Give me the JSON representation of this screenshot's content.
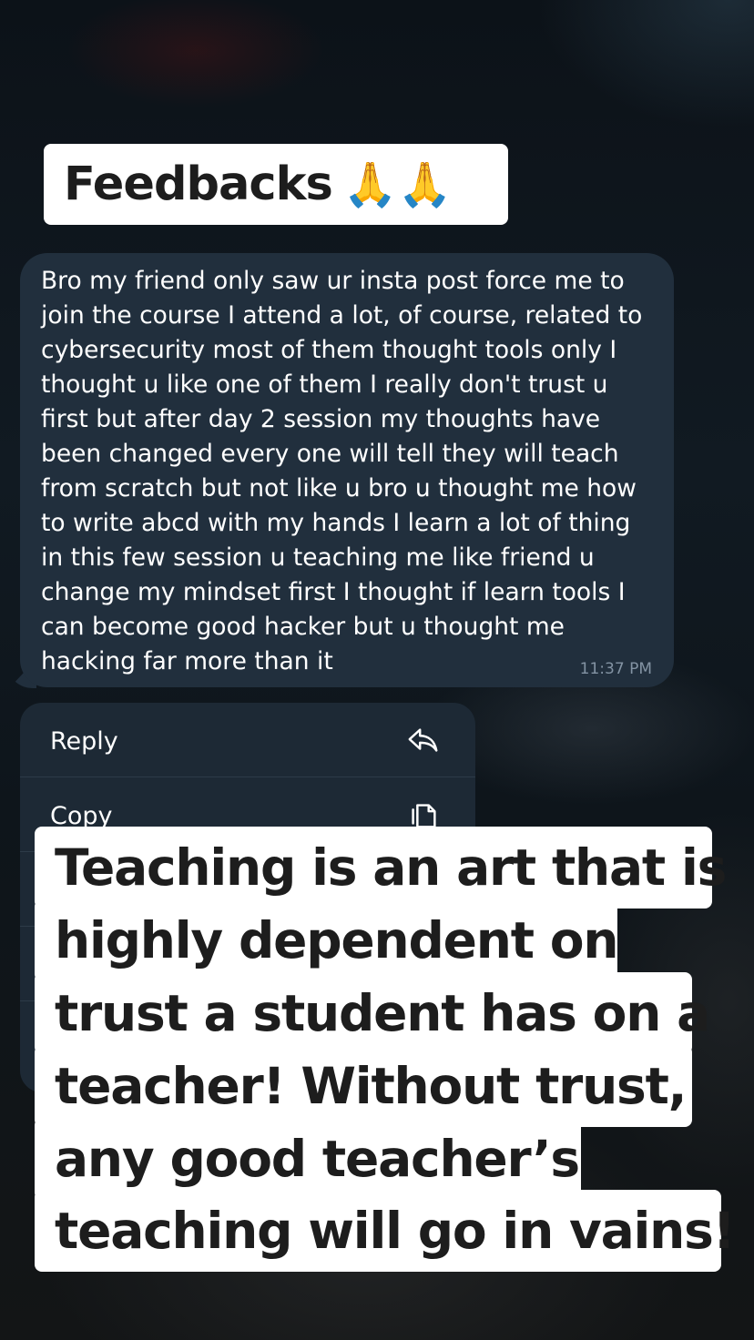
{
  "header": {
    "title": "Feedbacks",
    "emoji": "🙏🙏"
  },
  "message": {
    "lines": [
      "Bro my  friend only saw ur insta post force me to",
      "join the course I attend a lot, of course, related to",
      "cybersecurity most of them thought tools only I",
      "thought u like one of them I really don't trust u",
      "first but after day 2 session my thoughts have",
      "been changed every one will tell they will teach",
      "from scratch but not like u bro u thought me how",
      "to write abcd with my hands I learn a lot of thing",
      "in this few session u teaching me like friend u",
      "change my mindset first I thought if learn tools I",
      "can become good hacker but u thought me",
      "hacking far more than it"
    ],
    "time": "11:37 PM"
  },
  "context_menu": {
    "items": [
      {
        "label": "Reply",
        "icon": "reply-icon"
      },
      {
        "label": "Copy",
        "icon": "copy-icon"
      }
    ]
  },
  "quote": {
    "lines": [
      "Teaching is an art that is",
      "highly dependent on",
      "trust a student has on a",
      "teacher! Without trust,",
      "any good teacher’s",
      "teaching will go in vains!"
    ]
  },
  "colors": {
    "bubble": "#212f3d",
    "menu": "#1d2935",
    "overlay_box": "#ffffff",
    "overlay_text": "#1d1d1d",
    "time_text": "#8393a3"
  }
}
